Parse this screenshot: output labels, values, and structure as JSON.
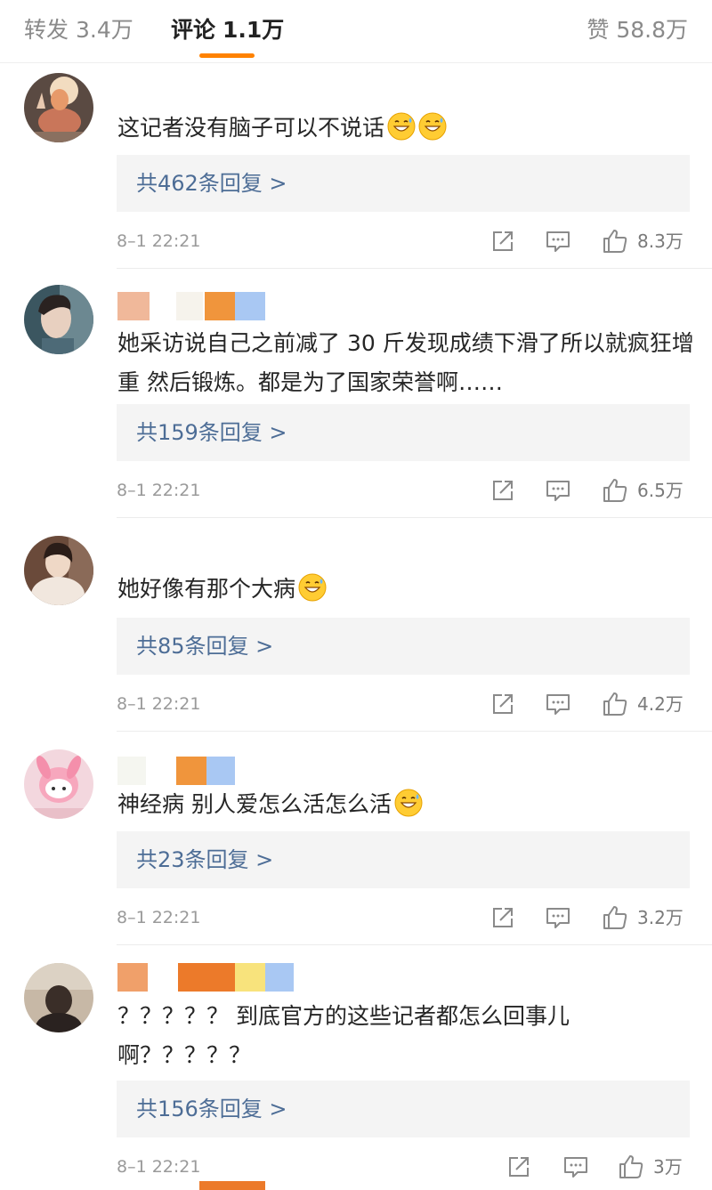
{
  "tabs": {
    "repost": {
      "label": "转发",
      "count": "3.4万"
    },
    "comments": {
      "label": "评论",
      "count": "1.1万"
    },
    "likes": {
      "label": "赞",
      "count": "58.8万"
    }
  },
  "colors": {
    "accent": "#ff8200",
    "reply_link": "#4d6d96",
    "reply_bg": "#f4f4f4",
    "meta_text": "#9a9a9a"
  },
  "icons": {
    "share": "share-icon",
    "comment": "comment-icon",
    "like": "thumbs-up-icon",
    "emoji": "grinning-sweat-emoji-icon"
  },
  "comments": [
    {
      "text": "这记者没有脑子可以不说话",
      "emoji_count": 2,
      "replies": "共462条回复 >",
      "time": "8–1 22:21",
      "likes": "8.3万"
    },
    {
      "text": "她采访说自己之前减了 30 斤发现成绩下滑了所以就疯狂增重 然后锻炼。都是为了国家荣誉啊……",
      "emoji_count": 0,
      "replies": "共159条回复 >",
      "time": "8–1 22:21",
      "likes": "6.5万"
    },
    {
      "text": "她好像有那个大病",
      "emoji_count": 1,
      "replies": "共85条回复 >",
      "time": "8–1 22:21",
      "likes": "4.2万"
    },
    {
      "text": "神经病 别人爱怎么活怎么活",
      "emoji_count": 1,
      "replies": "共23条回复 >",
      "time": "8–1 22:21",
      "likes": "3.2万"
    },
    {
      "text": "？？？？？ 到底官方的这些记者都怎么回事儿啊？？？？？",
      "emoji_count": 0,
      "replies": "共156条回复 >",
      "time": "8–1 22:21",
      "likes": "3万"
    }
  ]
}
